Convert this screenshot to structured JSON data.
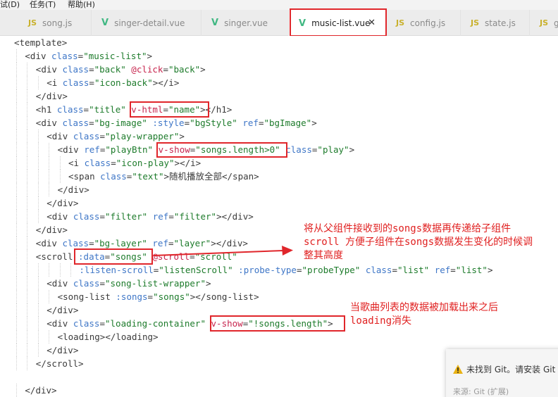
{
  "menu": [
    "试(D)",
    "任务(T)",
    "帮助(H)"
  ],
  "tabs": [
    {
      "label": "song.js",
      "icon": "JS",
      "kind": "js"
    },
    {
      "label": "singer-detail.vue",
      "icon": "V",
      "kind": "vue"
    },
    {
      "label": "singer.vue",
      "icon": "V",
      "kind": "vue"
    },
    {
      "label": "music-list.vue",
      "icon": "V",
      "kind": "vue",
      "active": true
    },
    {
      "label": "config.js",
      "icon": "JS",
      "kind": "js"
    },
    {
      "label": "state.js",
      "icon": "JS",
      "kind": "js"
    },
    {
      "label": "g",
      "icon": "JS",
      "kind": "js"
    }
  ],
  "close_glyph": "✕",
  "code_lines": [
    {
      "indent": 0,
      "tokens": [
        [
          "t",
          "<template>"
        ]
      ]
    },
    {
      "indent": 1,
      "tokens": [
        [
          "t",
          "<div "
        ],
        [
          "a",
          "class"
        ],
        [
          "t",
          "="
        ],
        [
          "s",
          "\"music-list\""
        ],
        [
          "t",
          ">"
        ]
      ]
    },
    {
      "indent": 2,
      "tokens": [
        [
          "t",
          "<div "
        ],
        [
          "a",
          "class"
        ],
        [
          "t",
          "="
        ],
        [
          "s",
          "\"back\""
        ],
        [
          "t",
          " "
        ],
        [
          "ev",
          "@click"
        ],
        [
          "t",
          "="
        ],
        [
          "s",
          "\"back\""
        ],
        [
          "t",
          ">"
        ]
      ]
    },
    {
      "indent": 3,
      "tokens": [
        [
          "t",
          "<i "
        ],
        [
          "a",
          "class"
        ],
        [
          "t",
          "="
        ],
        [
          "s",
          "\"icon-back\""
        ],
        [
          "t",
          "></i>"
        ]
      ]
    },
    {
      "indent": 2,
      "tokens": [
        [
          "t",
          "</div>"
        ]
      ]
    },
    {
      "indent": 2,
      "tokens": [
        [
          "t",
          "<h1 "
        ],
        [
          "a",
          "class"
        ],
        [
          "t",
          "="
        ],
        [
          "s",
          "\"title\""
        ],
        [
          "t",
          " "
        ],
        [
          "ev",
          "v-html"
        ],
        [
          "t",
          "="
        ],
        [
          "s",
          "\"name\""
        ],
        [
          "t",
          "></h1>"
        ]
      ]
    },
    {
      "indent": 2,
      "tokens": [
        [
          "t",
          "<div "
        ],
        [
          "a",
          "class"
        ],
        [
          "t",
          "="
        ],
        [
          "s",
          "\"bg-image\""
        ],
        [
          "t",
          " "
        ],
        [
          "a",
          ":style"
        ],
        [
          "t",
          "="
        ],
        [
          "s",
          "\"bgStyle\""
        ],
        [
          "t",
          " "
        ],
        [
          "a",
          "ref"
        ],
        [
          "t",
          "="
        ],
        [
          "s",
          "\"bgImage\""
        ],
        [
          "t",
          ">"
        ]
      ]
    },
    {
      "indent": 3,
      "tokens": [
        [
          "t",
          "<div "
        ],
        [
          "a",
          "class"
        ],
        [
          "t",
          "="
        ],
        [
          "s",
          "\"play-wrapper\""
        ],
        [
          "t",
          ">"
        ]
      ]
    },
    {
      "indent": 4,
      "tokens": [
        [
          "t",
          "<div "
        ],
        [
          "a",
          "ref"
        ],
        [
          "t",
          "="
        ],
        [
          "s",
          "\"playBtn\""
        ],
        [
          "t",
          " "
        ],
        [
          "ev",
          "v-show"
        ],
        [
          "t",
          "="
        ],
        [
          "s",
          "\"songs.length>0\""
        ],
        [
          "t",
          " "
        ],
        [
          "a",
          "class"
        ],
        [
          "t",
          "="
        ],
        [
          "s",
          "\"play\""
        ],
        [
          "t",
          ">"
        ]
      ]
    },
    {
      "indent": 5,
      "tokens": [
        [
          "t",
          "<i "
        ],
        [
          "a",
          "class"
        ],
        [
          "t",
          "="
        ],
        [
          "s",
          "\"icon-play\""
        ],
        [
          "t",
          "></i>"
        ]
      ]
    },
    {
      "indent": 5,
      "tokens": [
        [
          "t",
          "<span "
        ],
        [
          "a",
          "class"
        ],
        [
          "t",
          "="
        ],
        [
          "s",
          "\"text\""
        ],
        [
          "t",
          ">随机播放全部</span>"
        ]
      ]
    },
    {
      "indent": 4,
      "tokens": [
        [
          "t",
          "</div>"
        ]
      ]
    },
    {
      "indent": 3,
      "tokens": [
        [
          "t",
          "</div>"
        ]
      ]
    },
    {
      "indent": 3,
      "tokens": [
        [
          "t",
          "<div "
        ],
        [
          "a",
          "class"
        ],
        [
          "t",
          "="
        ],
        [
          "s",
          "\"filter\""
        ],
        [
          "t",
          " "
        ],
        [
          "a",
          "ref"
        ],
        [
          "t",
          "="
        ],
        [
          "s",
          "\"filter\""
        ],
        [
          "t",
          "></div>"
        ]
      ]
    },
    {
      "indent": 2,
      "tokens": [
        [
          "t",
          "</div>"
        ]
      ]
    },
    {
      "indent": 2,
      "tokens": [
        [
          "t",
          "<div "
        ],
        [
          "a",
          "class"
        ],
        [
          "t",
          "="
        ],
        [
          "s",
          "\"bg-layer\""
        ],
        [
          "t",
          " "
        ],
        [
          "a",
          "ref"
        ],
        [
          "t",
          "="
        ],
        [
          "s",
          "\"layer\""
        ],
        [
          "t",
          "></div>"
        ]
      ]
    },
    {
      "indent": 2,
      "tokens": [
        [
          "t",
          "<scroll "
        ],
        [
          "a",
          ":data"
        ],
        [
          "t",
          "="
        ],
        [
          "s",
          "\"songs\""
        ],
        [
          "t",
          " "
        ],
        [
          "ev",
          "@scroll"
        ],
        [
          "t",
          "="
        ],
        [
          "s",
          "\"scroll\""
        ]
      ]
    },
    {
      "indent": 6,
      "tokens": [
        [
          "a",
          ":listen-scroll"
        ],
        [
          "t",
          "="
        ],
        [
          "s",
          "\"listenScroll\""
        ],
        [
          "t",
          " "
        ],
        [
          "a",
          ":probe-type"
        ],
        [
          "t",
          "="
        ],
        [
          "s",
          "\"probeType\""
        ],
        [
          "t",
          " "
        ],
        [
          "a",
          "class"
        ],
        [
          "t",
          "="
        ],
        [
          "s",
          "\"list\""
        ],
        [
          "t",
          " "
        ],
        [
          "a",
          "ref"
        ],
        [
          "t",
          "="
        ],
        [
          "s",
          "\"list\""
        ],
        [
          "t",
          ">"
        ]
      ]
    },
    {
      "indent": 3,
      "tokens": [
        [
          "t",
          "<div "
        ],
        [
          "a",
          "class"
        ],
        [
          "t",
          "="
        ],
        [
          "s",
          "\"song-list-wrapper\""
        ],
        [
          "t",
          ">"
        ]
      ]
    },
    {
      "indent": 4,
      "tokens": [
        [
          "t",
          "<song-list "
        ],
        [
          "a",
          ":songs"
        ],
        [
          "t",
          "="
        ],
        [
          "s",
          "\"songs\""
        ],
        [
          "t",
          "></song-list>"
        ]
      ]
    },
    {
      "indent": 3,
      "tokens": [
        [
          "t",
          "</div>"
        ]
      ]
    },
    {
      "indent": 3,
      "tokens": [
        [
          "t",
          "<div "
        ],
        [
          "a",
          "class"
        ],
        [
          "t",
          "="
        ],
        [
          "s",
          "\"loading-container\""
        ],
        [
          "t",
          " "
        ],
        [
          "ev",
          "v-show"
        ],
        [
          "t",
          "="
        ],
        [
          "s",
          "\"!songs.length\""
        ],
        [
          "t",
          ">"
        ]
      ]
    },
    {
      "indent": 4,
      "tokens": [
        [
          "t",
          "<loading></loading>"
        ]
      ]
    },
    {
      "indent": 3,
      "tokens": [
        [
          "t",
          "</div>"
        ]
      ]
    },
    {
      "indent": 2,
      "tokens": [
        [
          "t",
          "</scroll>"
        ]
      ]
    },
    {
      "indent": 0,
      "tokens": [
        [
          "t",
          ""
        ]
      ]
    },
    {
      "indent": 1,
      "tokens": [
        [
          "t",
          "</div>"
        ]
      ]
    }
  ],
  "annotations": {
    "scroll_note": [
      "将从父组件接收到的songs数据再传递给子组件",
      "scroll 方便子组件在songs数据发生变化的时候调",
      "整其高度"
    ],
    "loading_note": [
      "当歌曲列表的数据被加载出来之后",
      "loading消失"
    ]
  },
  "toast": {
    "message": "未找到 Git。请安装 Git",
    "source": "来源: Git (扩展)"
  },
  "colors": {
    "highlight": "#e0262b",
    "annotation": "#e02020",
    "tag": "#3b3b3b",
    "attr": "#3e76c7",
    "string": "#1d7b2b",
    "directive": "#c7254e"
  }
}
